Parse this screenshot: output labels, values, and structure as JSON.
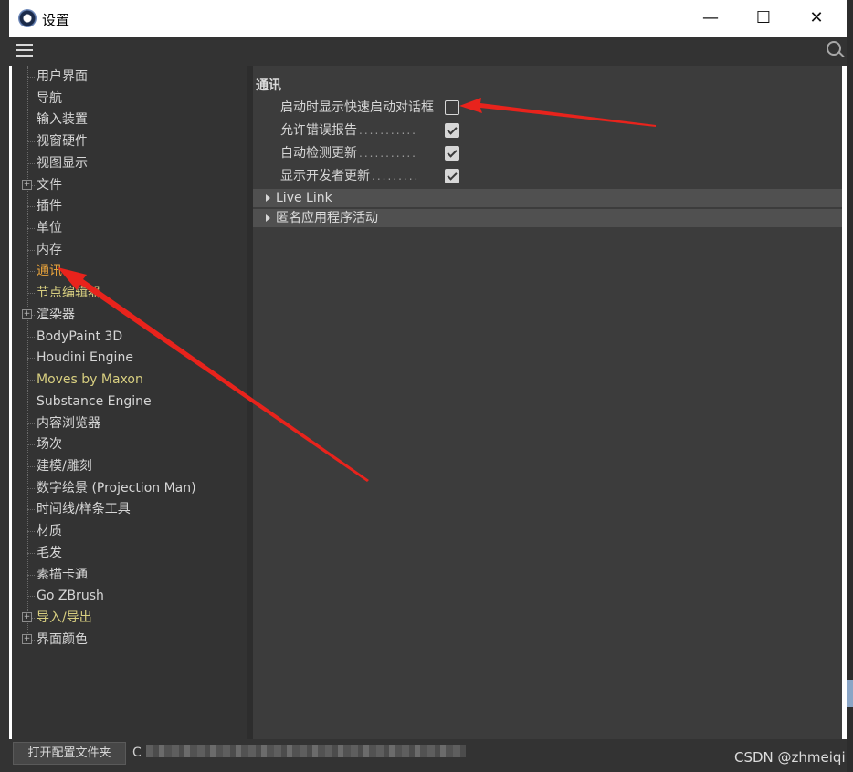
{
  "window": {
    "title": "设置",
    "minimize_symbol": "—",
    "maximize_symbol": "☐",
    "close_symbol": "✕"
  },
  "toolbar": {
    "menu_icon": "hamburger-menu-icon",
    "search_icon": "search-icon"
  },
  "sidebar": {
    "items": [
      {
        "label": "用户界面",
        "expandable": false,
        "color": "normal"
      },
      {
        "label": "导航",
        "expandable": false,
        "color": "normal"
      },
      {
        "label": "输入装置",
        "expandable": false,
        "color": "normal"
      },
      {
        "label": "视窗硬件",
        "expandable": false,
        "color": "normal"
      },
      {
        "label": "视图显示",
        "expandable": false,
        "color": "normal"
      },
      {
        "label": "文件",
        "expandable": true,
        "color": "normal"
      },
      {
        "label": "插件",
        "expandable": false,
        "color": "normal"
      },
      {
        "label": "单位",
        "expandable": false,
        "color": "normal"
      },
      {
        "label": "内存",
        "expandable": false,
        "color": "normal"
      },
      {
        "label": "通讯",
        "expandable": false,
        "color": "active"
      },
      {
        "label": "节点编辑器",
        "expandable": false,
        "color": "yellow"
      },
      {
        "label": "渲染器",
        "expandable": true,
        "color": "normal"
      },
      {
        "label": "BodyPaint 3D",
        "expandable": false,
        "color": "normal"
      },
      {
        "label": "Houdini Engine",
        "expandable": false,
        "color": "normal"
      },
      {
        "label": "Moves by Maxon",
        "expandable": false,
        "color": "yellow"
      },
      {
        "label": "Substance Engine",
        "expandable": false,
        "color": "normal"
      },
      {
        "label": "内容浏览器",
        "expandable": false,
        "color": "normal"
      },
      {
        "label": "场次",
        "expandable": false,
        "color": "normal"
      },
      {
        "label": "建模/雕刻",
        "expandable": false,
        "color": "normal"
      },
      {
        "label": "数字绘景 (Projection Man)",
        "expandable": false,
        "color": "normal"
      },
      {
        "label": "时间线/样条工具",
        "expandable": false,
        "color": "normal"
      },
      {
        "label": "材质",
        "expandable": false,
        "color": "normal"
      },
      {
        "label": "毛发",
        "expandable": false,
        "color": "normal"
      },
      {
        "label": "素描卡通",
        "expandable": false,
        "color": "normal"
      },
      {
        "label": "Go ZBrush",
        "expandable": false,
        "color": "normal"
      },
      {
        "label": "导入/导出",
        "expandable": true,
        "color": "yellow"
      },
      {
        "label": "界面颜色",
        "expandable": true,
        "color": "normal"
      }
    ]
  },
  "main": {
    "section_title": "通讯",
    "options": [
      {
        "label": "启动时显示快速启动对话框",
        "dots": "",
        "checked": false
      },
      {
        "label": "允许错误报告",
        "dots": "...........",
        "checked": true
      },
      {
        "label": "自动检测更新",
        "dots": "...........",
        "checked": true
      },
      {
        "label": "显示开发者更新",
        "dots": ".........",
        "checked": true
      }
    ],
    "groups": [
      {
        "label": "Live Link"
      },
      {
        "label": "匿名应用程序活动"
      }
    ]
  },
  "footer": {
    "open_config_button": "打开配置文件夹",
    "path_prefix": "C"
  },
  "watermark": "CSDN @zhmeiqi",
  "colors": {
    "panel_bg": "#333333",
    "content_bg": "#3c3c3c",
    "active_item": "#e9a33b",
    "yellow_item": "#d8cf80",
    "annotation_arrow": "#e8231c"
  }
}
